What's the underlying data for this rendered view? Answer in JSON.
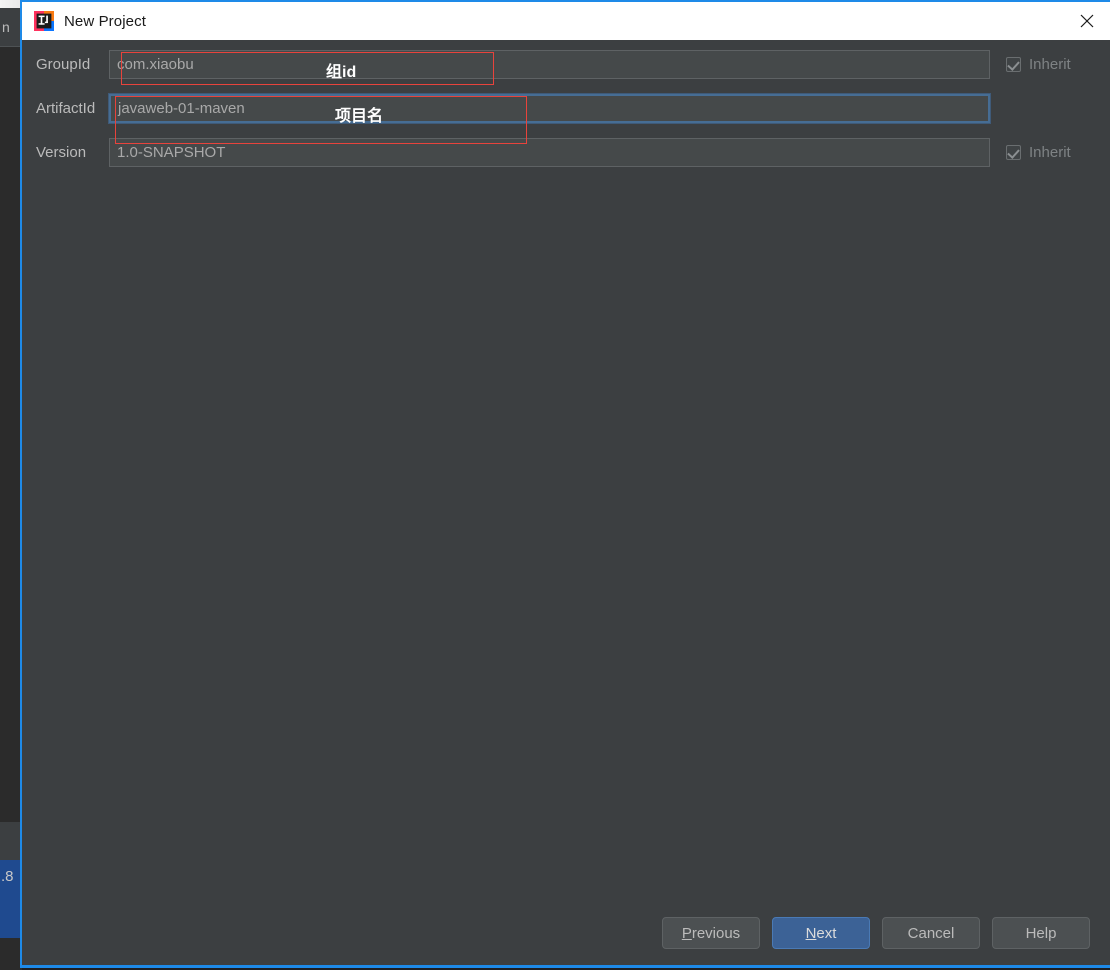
{
  "background": {
    "menu_fragment": "n",
    "selected_fragment": ".8"
  },
  "window": {
    "title": "New Project",
    "icon": "intellij-idea-icon",
    "close_icon": "close-icon",
    "border_color": "#1e8ae8",
    "titlebar_bg": "#ffffff",
    "body_bg": "#3c3f41"
  },
  "form": {
    "rows": [
      {
        "label": "GroupId",
        "value": "com.xiaobu",
        "inherit_label": "Inherit",
        "inherit_checked": true,
        "focused": false
      },
      {
        "label": "ArtifactId",
        "value": "javaweb-01-maven",
        "inherit_label": "",
        "inherit_checked": false,
        "focused": true
      },
      {
        "label": "Version",
        "value": "1.0-SNAPSHOT",
        "inherit_label": "Inherit",
        "inherit_checked": true,
        "focused": false
      }
    ]
  },
  "annotations": {
    "color": "#e8433c",
    "text_color": "#ffffff",
    "items": [
      {
        "text": "组id",
        "target": "groupid-field"
      },
      {
        "text": "项目名",
        "target": "artifactid-field"
      }
    ]
  },
  "footer": {
    "buttons": [
      {
        "label": "Previous",
        "mnemonic": "P",
        "rest": "revious",
        "default": false
      },
      {
        "label": "Next",
        "mnemonic": "N",
        "rest": "ext",
        "default": true
      },
      {
        "label": "Cancel",
        "mnemonic": "",
        "rest": "Cancel",
        "default": false
      },
      {
        "label": "Help",
        "mnemonic": "",
        "rest": "Help",
        "default": false
      }
    ]
  }
}
